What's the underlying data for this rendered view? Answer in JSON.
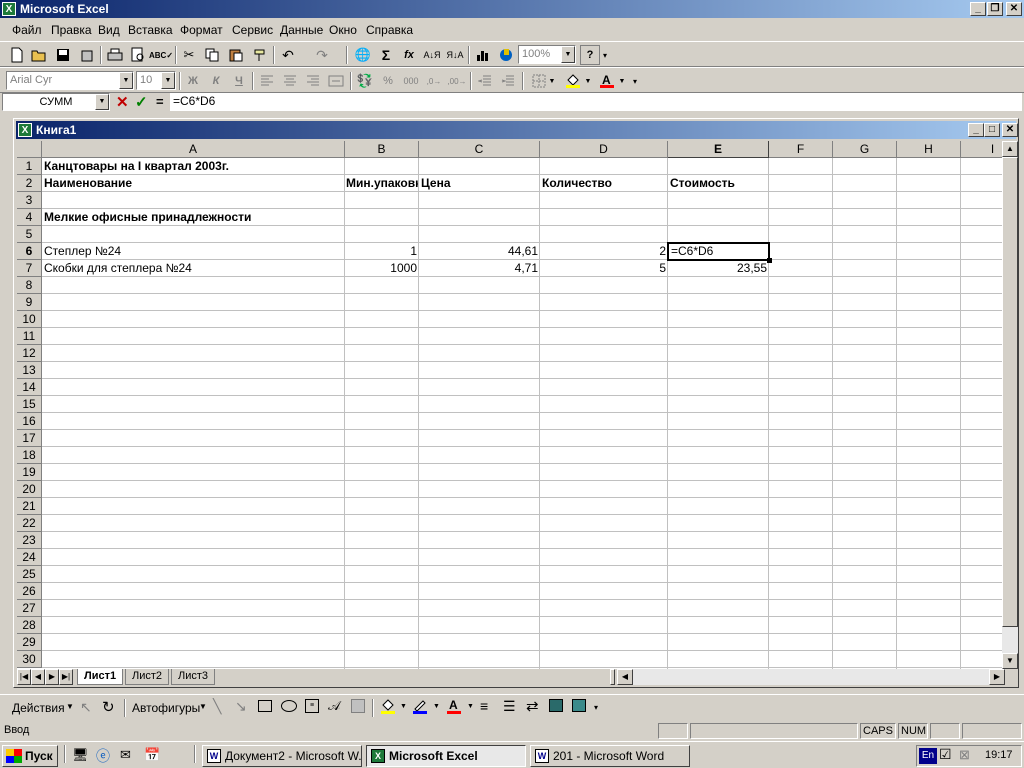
{
  "app": {
    "title": "Microsoft Excel",
    "icon_label": "X"
  },
  "window_buttons": [
    "_",
    "❐",
    "✕"
  ],
  "menu": [
    "Файл",
    "Правка",
    "Вид",
    "Вставка",
    "Формат",
    "Сервис",
    "Данные",
    "Окно",
    "Справка"
  ],
  "toolbar": {
    "zoom": "100%",
    "help": "?"
  },
  "format_toolbar": {
    "font": "Arial Cyr",
    "size": "10",
    "bold": "Ж",
    "italic": "К",
    "underline": "Ч",
    "percent": "%",
    "thousands": "000"
  },
  "formula": {
    "namebox": "СУММ",
    "cancel": "✕",
    "enter": "✓",
    "equals": "=",
    "content": "=C6*D6"
  },
  "workbook": {
    "title": "Книга1"
  },
  "columns": [
    "A",
    "B",
    "C",
    "D",
    "E",
    "F",
    "G",
    "H",
    "I"
  ],
  "rows": [
    "1",
    "2",
    "3",
    "4",
    "5",
    "6",
    "7",
    "8",
    "9",
    "10",
    "11",
    "12",
    "13",
    "14",
    "15",
    "16",
    "17",
    "18",
    "19",
    "20",
    "21",
    "22",
    "23",
    "24",
    "25",
    "26",
    "27",
    "28",
    "29",
    "30"
  ],
  "cells": {
    "A1": "Канцтовары на I квартал 2003г.",
    "A2": "Наименование",
    "B2": "Мин.упаковка",
    "C2": "Цена",
    "D2": "Количество",
    "E2": "Стоимость",
    "A4": "Мелкие офисные принадлежности",
    "A6": "Степлер №24",
    "B6": "1",
    "C6": "44,61",
    "D6": "2",
    "E6": "=C6*D6",
    "A7": "Скобки для степлера №24",
    "B7": "1000",
    "C7": "4,71",
    "D7": "5",
    "E7": "23,55"
  },
  "sheets": [
    "Лист1",
    "Лист2",
    "Лист3"
  ],
  "drawing": {
    "actions": "Действия",
    "autoshapes": "Автофигуры"
  },
  "status": {
    "mode": "Ввод",
    "caps": "CAPS",
    "num": "NUM"
  },
  "taskbar": {
    "start": "Пуск",
    "tasks": [
      "Документ2 - Microsoft W...",
      "Microsoft Excel",
      "201 - Microsoft Word"
    ],
    "lang": "En",
    "time": "19:17"
  }
}
